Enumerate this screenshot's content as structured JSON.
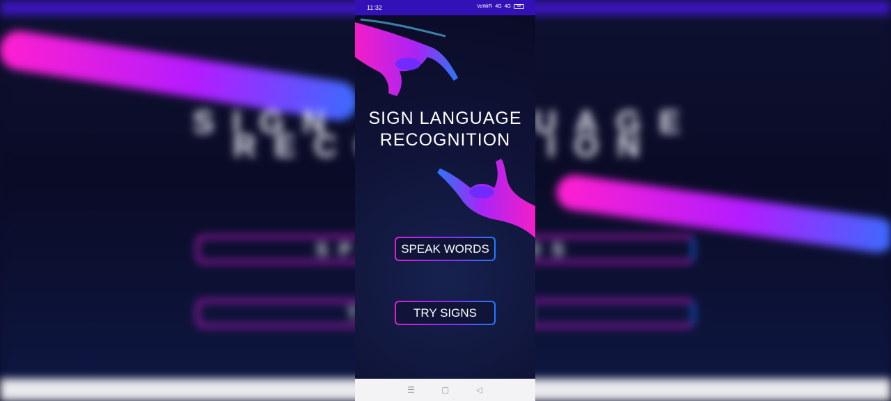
{
  "status_bar": {
    "time": "11:32",
    "icons": [
      "vowifi-icon",
      "data-icon",
      "signal-icon"
    ],
    "icon_text": [
      "VoWiFi",
      "4G",
      "4G"
    ],
    "battery_level": "68"
  },
  "app": {
    "title_line1": "SIGN LANGUAGE",
    "title_line2": "RECOGNITION",
    "buttons": {
      "speak_words": "SPEAK WORDS",
      "try_signs": "TRY SIGNS"
    },
    "colors": {
      "background": "#0c0f2e",
      "status_bar": "#3411b6",
      "accent_pink": "#e01fd8",
      "accent_blue": "#1f7dff"
    }
  },
  "nav_bar": {
    "menu_icon": "☰",
    "home_icon": "▢",
    "back_icon": "◁"
  }
}
